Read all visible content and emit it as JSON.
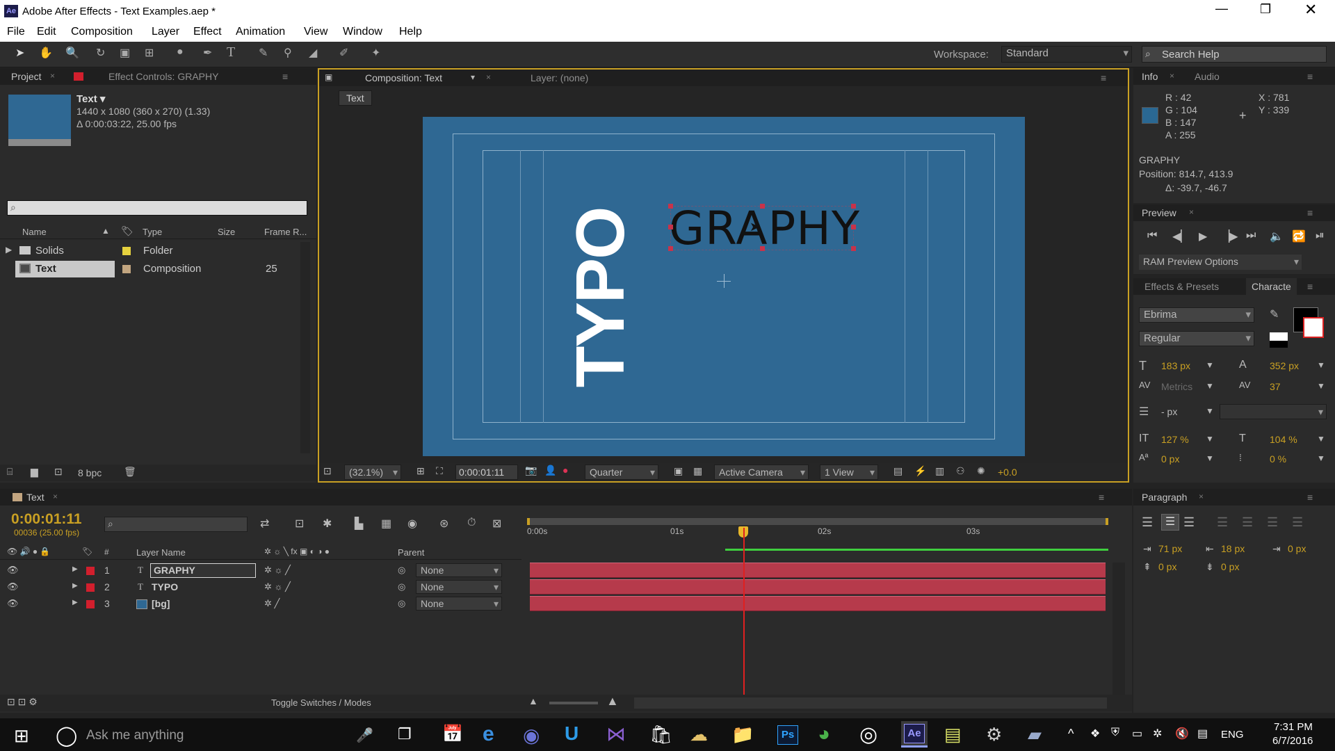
{
  "window": {
    "title": "Adobe After Effects - Text Examples.aep *",
    "app_icon": "Ae"
  },
  "menu": [
    "File",
    "Edit",
    "Composition",
    "Layer",
    "Effect",
    "Animation",
    "View",
    "Window",
    "Help"
  ],
  "toolbar": {
    "workspace_label": "Workspace:",
    "workspace_value": "Standard",
    "search_placeholder": "Search Help"
  },
  "project": {
    "tab": "Project",
    "effect_controls_tab": "Effect Controls: GRAPHY",
    "item_name": "Text ▾",
    "item_res": "1440 x 1080  (360 x 270) (1.33)",
    "item_dur": "Δ 0:00:03:22, 25.00 fps",
    "columns": [
      "Name",
      "Type",
      "Size",
      "Frame R..."
    ],
    "rows": [
      {
        "name": "Solids",
        "type": "Folder",
        "size": "",
        "fr": ""
      },
      {
        "name": "Text",
        "type": "Composition",
        "size": "",
        "fr": "25"
      }
    ],
    "bpc": "8 bpc"
  },
  "comp": {
    "tab": "Composition: Text",
    "layer_tab": "Layer: (none)",
    "crumb": "Text",
    "typo": "TYPO",
    "graphy": "GRAPHY",
    "zoom": "(32.1%)",
    "time": "0:00:01:11",
    "resolution": "Quarter",
    "camera": "Active Camera",
    "view": "1 View",
    "exposure": "+0.0"
  },
  "info": {
    "tab": "Info",
    "audio_tab": "Audio",
    "r": "R : 42",
    "g": "G : 104",
    "b": "B : 147",
    "a": "A : 255",
    "x": "X : 781",
    "y": "Y : 339",
    "layer": "GRAPHY",
    "pos": "Position: 814.7, 413.9",
    "delta": "Δ: -39.7, -46.7",
    "swatch": "#2a6893"
  },
  "preview": {
    "tab": "Preview",
    "ram": "RAM Preview Options"
  },
  "character": {
    "effects_tab": "Effects & Presets",
    "tab": "Characte",
    "font": "Ebrima",
    "style": "Regular",
    "size": "183 px",
    "leading": "352 px",
    "kerning": "Metrics",
    "tracking": "37",
    "stroke": "- px",
    "vscale": "127 %",
    "hscale": "104 %",
    "baseline": "0 px",
    "tsume": "0 %"
  },
  "paragraph": {
    "tab": "Paragraph",
    "indent_left": "71 px",
    "indent_right": "18 px",
    "indent_first": "0 px",
    "space_before": "0 px",
    "space_after": "0 px"
  },
  "timeline": {
    "tab": "Text",
    "timecode": "0:00:01:11",
    "frames": "00036 (25.00 fps)",
    "col_layer": "Layer Name",
    "col_parent": "Parent",
    "ruler": [
      "0:00s",
      "01s",
      "02s",
      "03s"
    ],
    "toggle": "Toggle Switches / Modes",
    "layers": [
      {
        "num": "1",
        "name": "GRAPHY",
        "type": "T",
        "parent": "None"
      },
      {
        "num": "2",
        "name": "TYPO",
        "type": "T",
        "parent": "None"
      },
      {
        "num": "3",
        "name": "[bg]",
        "type": "",
        "parent": "None"
      }
    ]
  },
  "taskbar": {
    "search": "Ask me anything",
    "lang": "ENG",
    "time": "7:31 PM",
    "date": "6/7/2016"
  },
  "colors": {
    "comp_bg": "#2f6893",
    "accent": "#c9a023",
    "layer_red": "#b63a4b",
    "playhead": "#e02020"
  }
}
